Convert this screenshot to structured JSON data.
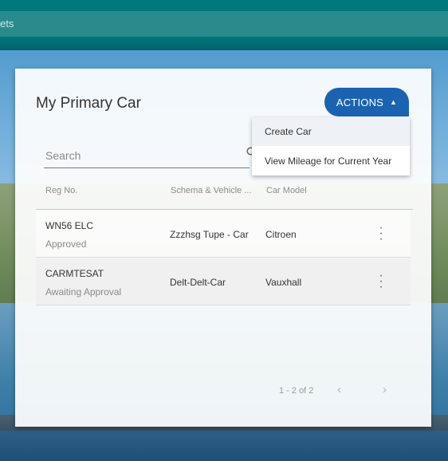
{
  "nav": {
    "partial_text": "ets"
  },
  "card": {
    "title": "My Primary Car",
    "actions_label": "ACTIONS",
    "actions_caret": "▲"
  },
  "search": {
    "placeholder": "Search",
    "icon": "search-icon"
  },
  "table": {
    "columns": [
      "Reg No.",
      "Schema & Vehicle ...",
      "Car Model"
    ],
    "rows": [
      {
        "reg": "WN56 ELC",
        "status": "Approved",
        "schema": "Zzzhsg Tupe - Car",
        "model": "Citroen"
      },
      {
        "reg": "CARMTESAT",
        "status": "Awaiting Approval",
        "schema": "Delt-Delt-Car",
        "model": "Vauxhall"
      }
    ]
  },
  "pagination": {
    "summary": "1 - 2 of 2",
    "prev": "‹",
    "next": "›"
  },
  "actions_menu": {
    "items": [
      "Create Car",
      "View Mileage for Current Year"
    ]
  },
  "colors": {
    "accent": "#1b63b0",
    "topbar": "#00787c"
  }
}
